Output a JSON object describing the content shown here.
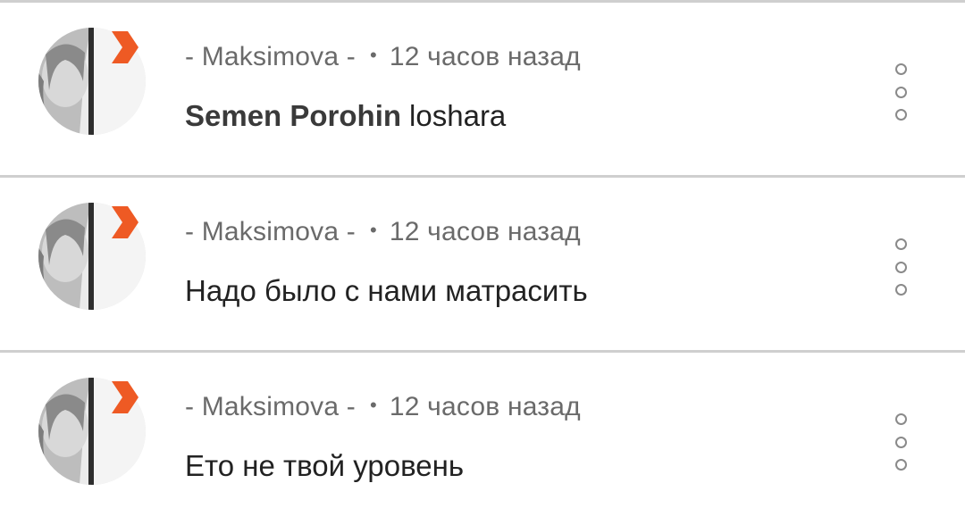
{
  "comments": [
    {
      "author": "- Maksimova -",
      "time": "12 часов назад",
      "mention": "Semen Porohin",
      "text": "loshara"
    },
    {
      "author": "- Maksimova -",
      "time": "12 часов назад",
      "mention": "",
      "text": "Надо было с нами матрасить"
    },
    {
      "author": "- Maksimova -",
      "time": "12 часов назад",
      "mention": "",
      "text": "Ето не твой уровень"
    }
  ],
  "separator": "•",
  "colors": {
    "badge": "#ee5a24",
    "divider": "#cfcfcf",
    "meta_text": "#6a6a6a",
    "body_text": "#222222"
  },
  "icons": {
    "badge": "orange-chevron-badge-icon",
    "menu": "more-options-vertical-dots-icon"
  }
}
